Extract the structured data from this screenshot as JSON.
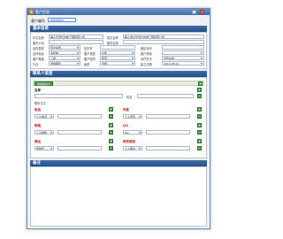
{
  "window": {
    "title": "客户信息"
  },
  "customer_no": {
    "label": "客户编号",
    "value": "0000000"
  },
  "basic": {
    "title": "基本信息",
    "rows": [
      [
        {
          "label": "中文名称",
          "value": "每人天津长益电工程有限公司"
        },
        {
          "label": "英文名称",
          "value": "每人测试天津长益电工程有限公司"
        }
      ],
      [
        {
          "label": "股东公司",
          "value": ""
        },
        {
          "label": "股东信用",
          "value": ""
        }
      ],
      [
        {
          "label": "证件类型",
          "value": "营业执照"
        },
        {
          "label": "证件号",
          "value": ""
        },
        {
          "label": "固定资本",
          "value": ""
        }
      ],
      [
        {
          "label": "证件地址",
          "value": "多媒体"
        },
        {
          "label": "客户类型",
          "value": "IT类"
        },
        {
          "label": "客户来源",
          "value": ""
        }
      ],
      [
        {
          "label": "客户等级",
          "value": "三级"
        },
        {
          "label": "客户性质",
          "value": "民营"
        },
        {
          "label": "合作方式",
          "value": "合作伙伴"
        }
      ],
      [
        {
          "label": "行业",
          "value": "通信服务"
        },
        {
          "label": "级别",
          "value": "合规"
        },
        {
          "label": "建立日期",
          "value": "2013-08-10"
        }
      ]
    ]
  },
  "contacts": {
    "title": "联系人信息",
    "add_label": "添加联系人",
    "name_label": "名称",
    "name_value": "",
    "name_field2": "姓名",
    "remark_label": "联系方式",
    "groups": [
      {
        "label": "电话",
        "select": "个人电话",
        "label2": "传真",
        "select2": "个人传真"
      },
      {
        "label": "邮箱",
        "select": "个人邮箱",
        "label2": "QQ",
        "select2": "QQ"
      },
      {
        "label": "微信",
        "select": "微信号",
        "label2": "网页链接",
        "select2": "个人网址"
      }
    ]
  },
  "notes": {
    "title": "备注"
  }
}
